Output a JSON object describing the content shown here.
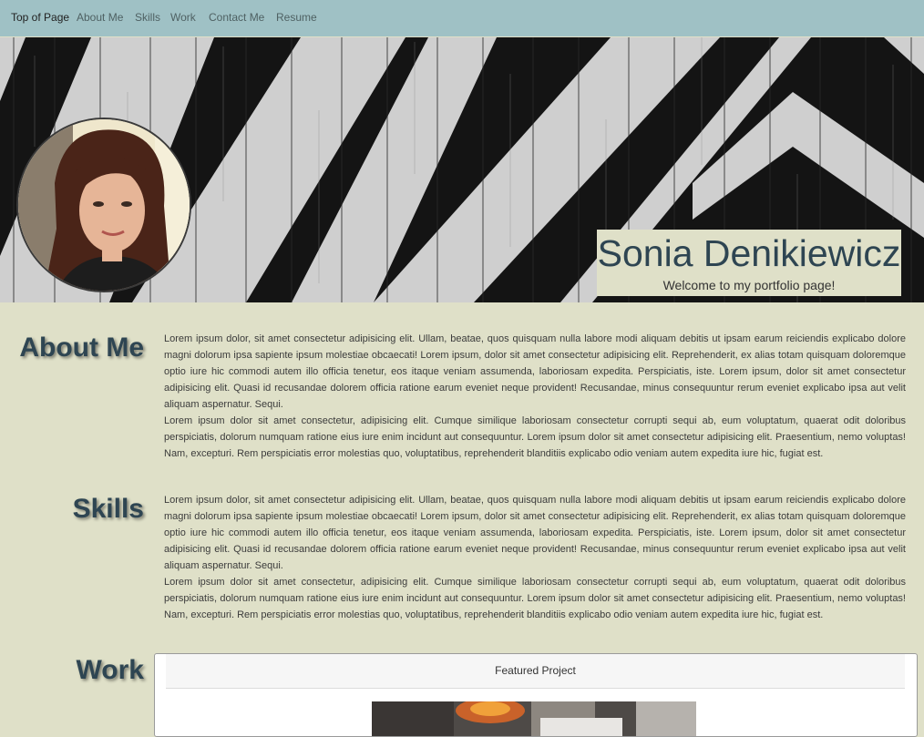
{
  "nav": {
    "items": [
      {
        "label": "Top of Page"
      },
      {
        "label": "About Me"
      },
      {
        "label": "Skills"
      },
      {
        "label": "Work"
      },
      {
        "label": "Contact Me"
      },
      {
        "label": "Resume"
      }
    ]
  },
  "hero": {
    "name": "Sonia Denikiewicz",
    "tagline": "Welcome to my portfolio page!"
  },
  "about": {
    "title": "About Me",
    "paragraphs": [
      "Lorem ipsum dolor, sit amet consectetur adipisicing elit. Ullam, beatae, quos quisquam nulla labore modi aliquam debitis ut ipsam earum reiciendis explicabo dolore magni dolorum ipsa sapiente ipsum molestiae obcaecati! Lorem ipsum, dolor sit amet consectetur adipisicing elit. Reprehenderit, ex alias totam quisquam doloremque optio iure hic commodi autem illo officia tenetur, eos itaque veniam assumenda, laboriosam expedita. Perspiciatis, iste. Lorem ipsum, dolor sit amet consectetur adipisicing elit. Quasi id recusandae dolorem officia ratione earum eveniet neque provident! Recusandae, minus consequuntur rerum eveniet explicabo ipsa aut velit aliquam aspernatur. Sequi.",
      "Lorem ipsum dolor sit amet consectetur, adipisicing elit. Cumque similique laboriosam consectetur corrupti sequi ab, eum voluptatum, quaerat odit doloribus perspiciatis, dolorum numquam ratione eius iure enim incidunt aut consequuntur. Lorem ipsum dolor sit amet consectetur adipisicing elit. Praesentium, nemo voluptas! Nam, excepturi. Rem perspiciatis error molestias quo, voluptatibus, reprehenderit blanditiis explicabo odio veniam autem expedita iure hic, fugiat est."
    ]
  },
  "skills": {
    "title": "Skills",
    "paragraphs": [
      "Lorem ipsum dolor, sit amet consectetur adipisicing elit. Ullam, beatae, quos quisquam nulla labore modi aliquam debitis ut ipsam earum reiciendis explicabo dolore magni dolorum ipsa sapiente ipsum molestiae obcaecati! Lorem ipsum, dolor sit amet consectetur adipisicing elit. Reprehenderit, ex alias totam quisquam doloremque optio iure hic commodi autem illo officia tenetur, eos itaque veniam assumenda, laboriosam expedita. Perspiciatis, iste. Lorem ipsum, dolor sit amet consectetur adipisicing elit. Quasi id recusandae dolorem officia ratione earum eveniet neque provident! Recusandae, minus consequuntur rerum eveniet explicabo ipsa aut velit aliquam aspernatur. Sequi.",
      "Lorem ipsum dolor sit amet consectetur, adipisicing elit. Cumque similique laboriosam consectetur corrupti sequi ab, eum voluptatum, quaerat odit doloribus perspiciatis, dolorum numquam ratione eius iure enim incidunt aut consequuntur. Lorem ipsum dolor sit amet consectetur adipisicing elit. Praesentium, nemo voluptas! Nam, excepturi. Rem perspiciatis error molestias quo, voluptatibus, reprehenderit blanditiis explicabo odio veniam autem expedita iure hic, fugiat est."
    ]
  },
  "work": {
    "title": "Work",
    "card_header": "Featured Project"
  },
  "colors": {
    "navbar": "#9fc1c5",
    "page_background": "#dfe0c8",
    "heading": "#2e4552"
  }
}
